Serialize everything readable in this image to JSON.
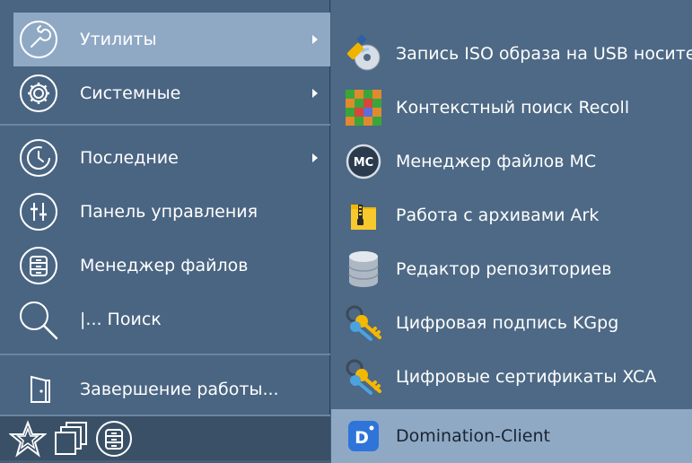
{
  "left_menu": {
    "items": [
      {
        "label": "Утилиты",
        "icon": "wrench-icon",
        "has_submenu": true,
        "active": true
      },
      {
        "label": "Системные",
        "icon": "gear-icon",
        "has_submenu": true,
        "active": false
      },
      {
        "label": "Последние",
        "icon": "clock-icon",
        "has_submenu": true,
        "active": false
      },
      {
        "label": "Панель управления",
        "icon": "sliders-icon",
        "has_submenu": false,
        "active": false
      },
      {
        "label": "Менеджер файлов",
        "icon": "file-cabinet-icon",
        "has_submenu": false,
        "active": false
      },
      {
        "label": "|... Поиск",
        "icon": "search-icon",
        "has_submenu": false,
        "active": false
      },
      {
        "label": "Завершение работы...",
        "icon": "exit-door-icon",
        "has_submenu": false,
        "active": false
      }
    ],
    "bottom_icons": [
      "favorites-star-icon",
      "windows-icon",
      "file-cabinet-icon"
    ]
  },
  "right_menu": {
    "items": [
      {
        "label": "Запись ISO образа на USB носитель",
        "icon": "iso-usb-writer-icon",
        "active": false
      },
      {
        "label": "Контекстный поиск Recoll",
        "icon": "recoll-icon",
        "active": false
      },
      {
        "label": "Менеджер файлов MC",
        "icon": "mc-icon",
        "icon_text": "MC",
        "active": false
      },
      {
        "label": "Работа с архивами Ark",
        "icon": "archive-icon",
        "active": false
      },
      {
        "label": "Редактор репозиториев",
        "icon": "database-icon",
        "active": false
      },
      {
        "label": "Цифровая подпись KGpg",
        "icon": "keys-icon",
        "active": false
      },
      {
        "label": "Цифровые сертификаты XCA",
        "icon": "keys-icon",
        "active": false
      },
      {
        "label": "Domination-Client",
        "icon": "domination-client-icon",
        "icon_text": "D",
        "active": true
      }
    ]
  },
  "colors": {
    "left_bg": "#4a6582",
    "right_bg": "#4d6985",
    "highlight": "#8fa9c4",
    "text": "#ffffff"
  }
}
